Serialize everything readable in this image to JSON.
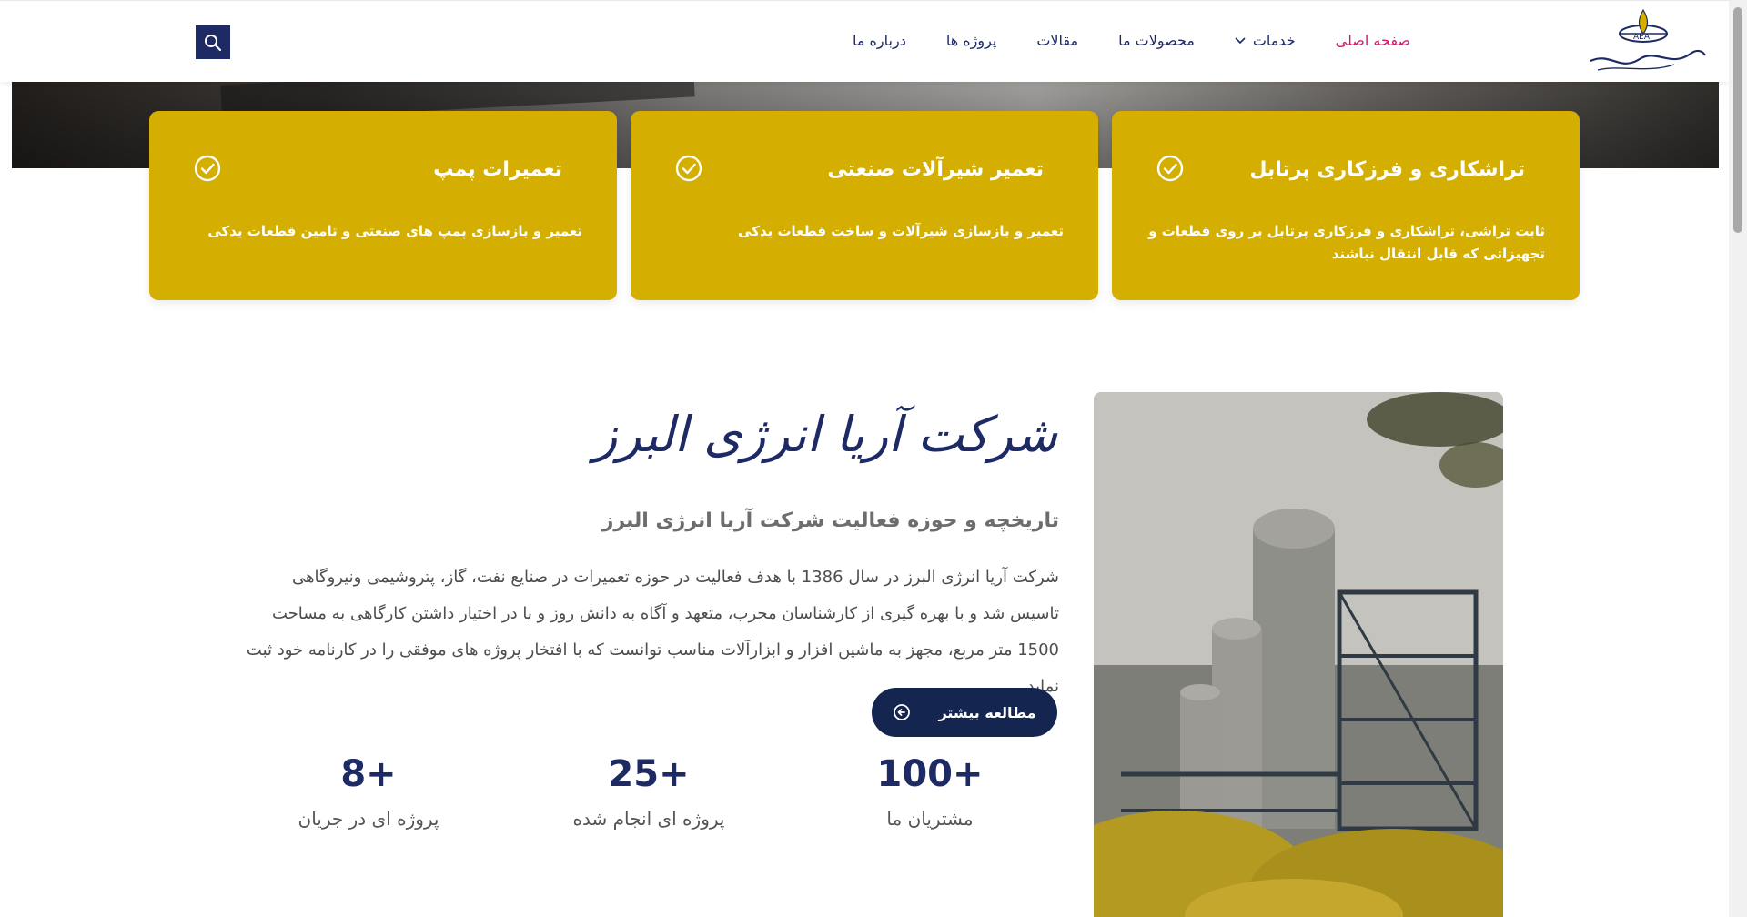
{
  "header": {
    "logo_text": "شرکت آریا انرژی البرز",
    "nav": [
      {
        "label": "صفحه اصلی",
        "active": true,
        "dropdown": false
      },
      {
        "label": "خدمات",
        "active": false,
        "dropdown": true
      },
      {
        "label": "محصولات ما",
        "active": false,
        "dropdown": false
      },
      {
        "label": "مقالات",
        "active": false,
        "dropdown": false
      },
      {
        "label": "پروژه ها",
        "active": false,
        "dropdown": false
      },
      {
        "label": "درباره ما",
        "active": false,
        "dropdown": false
      }
    ],
    "search_icon": "search-icon"
  },
  "cards": [
    {
      "title": "تراشکاری و فرزکاری پرتابل",
      "desc": "ثابت تراشی، تراشکاری و فرزکاری پرتابل بر روی قطعات و تجهیزاتی که قابل انتقال نباشند"
    },
    {
      "title": "تعمیر شیرآلات صنعتی",
      "desc": "تعمیر و بازسازی شیرآلات و ساخت قطعات یدکی"
    },
    {
      "title": "تعمیرات پمپ",
      "desc": "تعمیر و بازسازی پمپ های صنعتی و تامین قطعات یدکی"
    }
  ],
  "about": {
    "script_title": "شرکت آریا انرژی البرز",
    "subtitle": "تاریخچه و حوزه فعالیت شرکت آریا انرژی البرز",
    "body": "شرکت آریا انرژی البرز در سال 1386 با هدف فعالیت در حوزه تعمیرات در صنایع نفت، گاز، پتروشیمی ونیروگاهی تاسیس شد و با بهره گیری از کارشناسان مجرب، متعهد و آگاه به دانش روز و با در اختیار داشتن کارگاهی به مساحت 1500 متر مربع، مجهز  به ماشین افزار و ابزارآلات مناسب توانست که با افتخار پروژه های موفقی را در کارنامه خود ثبت نماید.",
    "read_more": "مطالعه بیشتر"
  },
  "stats": [
    {
      "value": "100+",
      "label": "مشتریان ما"
    },
    {
      "value": "25+",
      "label": "پروژه ای انجام شده"
    },
    {
      "value": "8+",
      "label": "پروژه ای در جریان"
    }
  ],
  "colors": {
    "card_bg": "#d4ae00",
    "nav_text": "#1c2a6b",
    "nav_active": "#d6186d",
    "primary_dark": "#14264f"
  }
}
